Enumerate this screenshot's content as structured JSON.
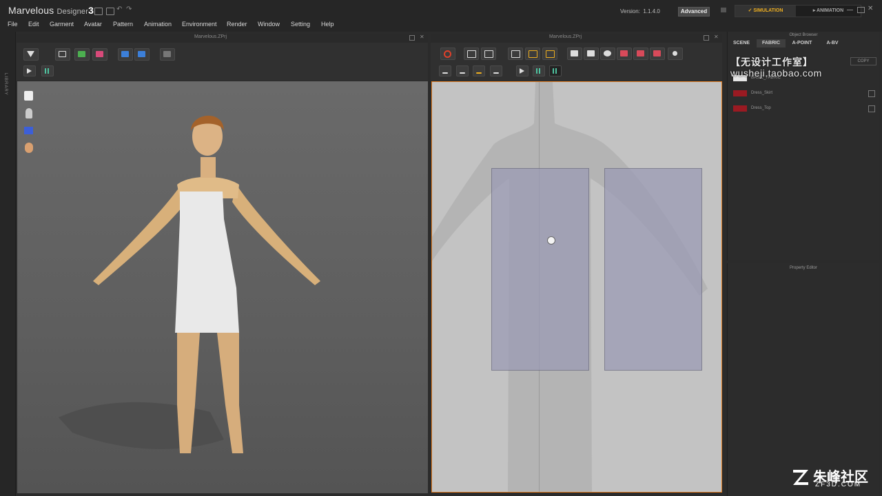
{
  "app": {
    "name": "Marvelous",
    "name_suffix": "Designer",
    "version_num": "3",
    "version_label": "Version:",
    "version_value": "1.1.4.0",
    "mode_badge": "Advanced"
  },
  "mode_tabs": {
    "simulation": "SIMULATION",
    "animation": "ANIMATION"
  },
  "menu": [
    "File",
    "Edit",
    "Garment",
    "Avatar",
    "Pattern",
    "Animation",
    "Environment",
    "Render",
    "Window",
    "Setting",
    "Help"
  ],
  "library_label": "LIBRARY",
  "window3d": {
    "title": "Marvelous.ZPrj"
  },
  "window2d": {
    "title": "Marvelous.ZPrj"
  },
  "object_browser": {
    "title": "Object Browser",
    "tabs": [
      "SCENE",
      "FABRIC",
      "A-POINT",
      "A-BV"
    ],
    "active_tab": "FABRIC",
    "copy_label": "COPY",
    "fabrics": [
      {
        "name": "BASIC_FABRIC",
        "color": "#e6e6e6"
      },
      {
        "name": "Dress_Skirt",
        "color": "#9a1a22"
      },
      {
        "name": "Dress_Top",
        "color": "#9a1a22"
      }
    ]
  },
  "property_editor": {
    "title": "Property Editor"
  },
  "colors": {
    "accent_orange": "#e07b20",
    "sim_yellow": "#f0b020",
    "pattern_fill": "#9b9bb5"
  },
  "watermarks": {
    "top_cn": "【无设计工作室】",
    "top_url": "wusheji.taobao.com",
    "bottom_cn": "朱峰社区",
    "bottom_url": "ZF3D.COM"
  }
}
